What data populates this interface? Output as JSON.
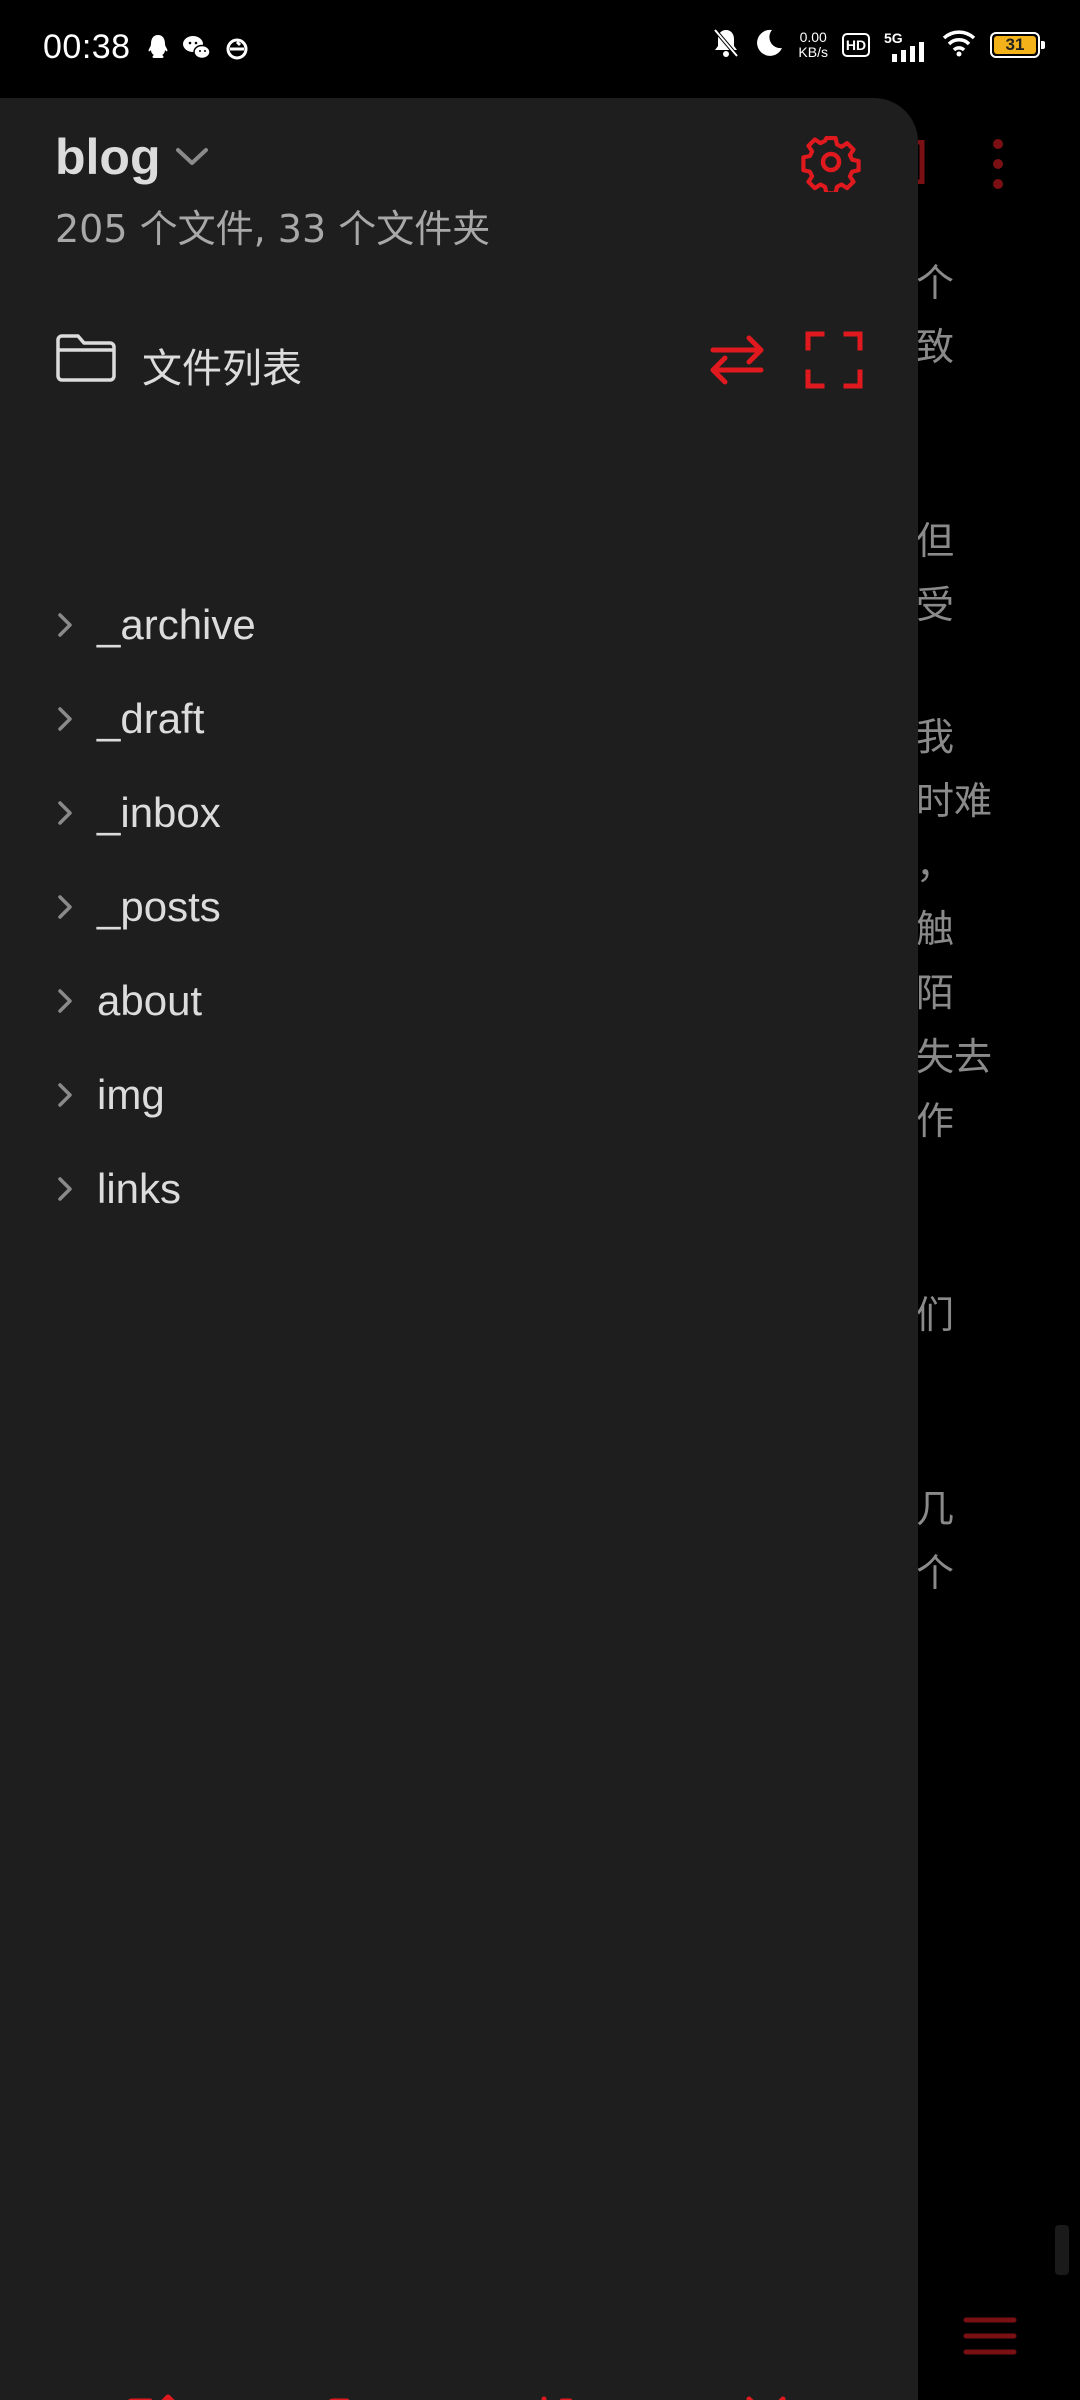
{
  "status_bar": {
    "time": "00:38",
    "speed_value": "0.00",
    "speed_unit": "KB/s",
    "hd": "HD",
    "network": "5G",
    "battery_level": "31",
    "left_icons": [
      "qq-icon",
      "wechat-icon",
      "sync-icon"
    ],
    "right_icons": [
      "silent-bell-icon",
      "moon-icon",
      "signal-icon",
      "wifi-icon",
      "battery-icon"
    ]
  },
  "drawer": {
    "vault_name": "blog",
    "vault_stats": "205 个文件, 33 个文件夹",
    "list_title": "文件列表",
    "items": [
      {
        "label": "_archive"
      },
      {
        "label": "_draft"
      },
      {
        "label": "_inbox"
      },
      {
        "label": "_posts"
      },
      {
        "label": "about"
      },
      {
        "label": "img"
      },
      {
        "label": "links"
      }
    ]
  },
  "background_editor": {
    "lines": [
      "个",
      "致",
      "但",
      "受",
      "我",
      "时难",
      "，",
      "触",
      "陌",
      "失去",
      "作",
      "们",
      "几",
      "个"
    ]
  },
  "colors": {
    "accent": "#e0191f",
    "drawer_bg": "#1e1e1e",
    "text_primary": "#dcdcdc",
    "text_secondary": "#a8a8a8",
    "background": "#000000",
    "battery": "#f3b21a"
  },
  "icons": {
    "settings": "gear-icon",
    "swap": "swap-arrows-icon",
    "expand": "fullscreen-corners-icon",
    "folder": "folder-icon",
    "new_note": "pencil-square-icon",
    "new_folder": "folder-plus-icon",
    "sort": "sort-descending-icon",
    "collapse": "collapse-all-icon",
    "menu": "hamburger-menu-icon"
  }
}
